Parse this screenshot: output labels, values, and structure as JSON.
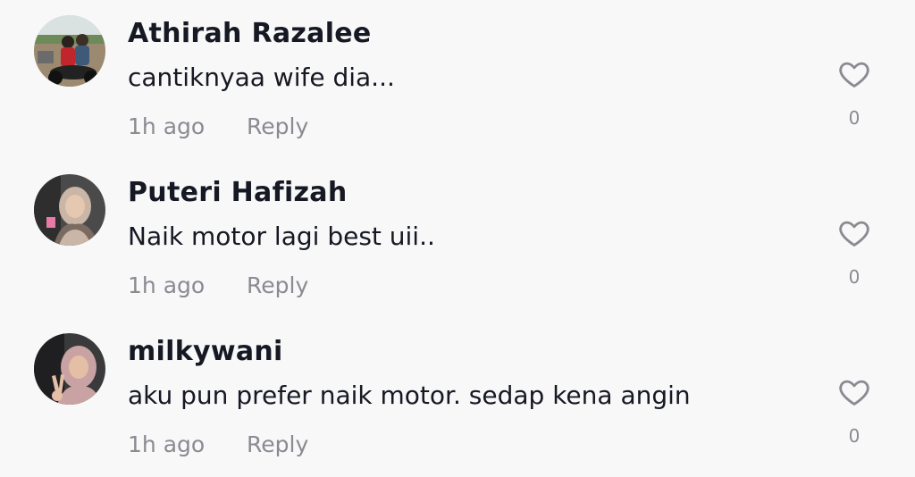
{
  "comments": [
    {
      "username": "Athirah Razalee",
      "text": "cantiknyaa wife dia...",
      "time": "1h ago",
      "reply_label": "Reply",
      "likes": "0",
      "avatar_icon": "avatar-photo-motorcycle-couple"
    },
    {
      "username": "Puteri Hafizah",
      "text": "Naik motor lagi best uii..",
      "time": "1h ago",
      "reply_label": "Reply",
      "likes": "0",
      "avatar_icon": "avatar-photo-hijab-woman"
    },
    {
      "username": "milkywani",
      "text": "aku pun prefer naik motor. sedap kena angin",
      "time": "1h ago",
      "reply_label": "Reply",
      "likes": "0",
      "avatar_icon": "avatar-photo-hijab-peace-sign"
    }
  ],
  "colors": {
    "background": "#f8f8f8",
    "primary_text": "#161823",
    "secondary_text": "#8a8b91",
    "like_icon": "#8a8b91"
  }
}
